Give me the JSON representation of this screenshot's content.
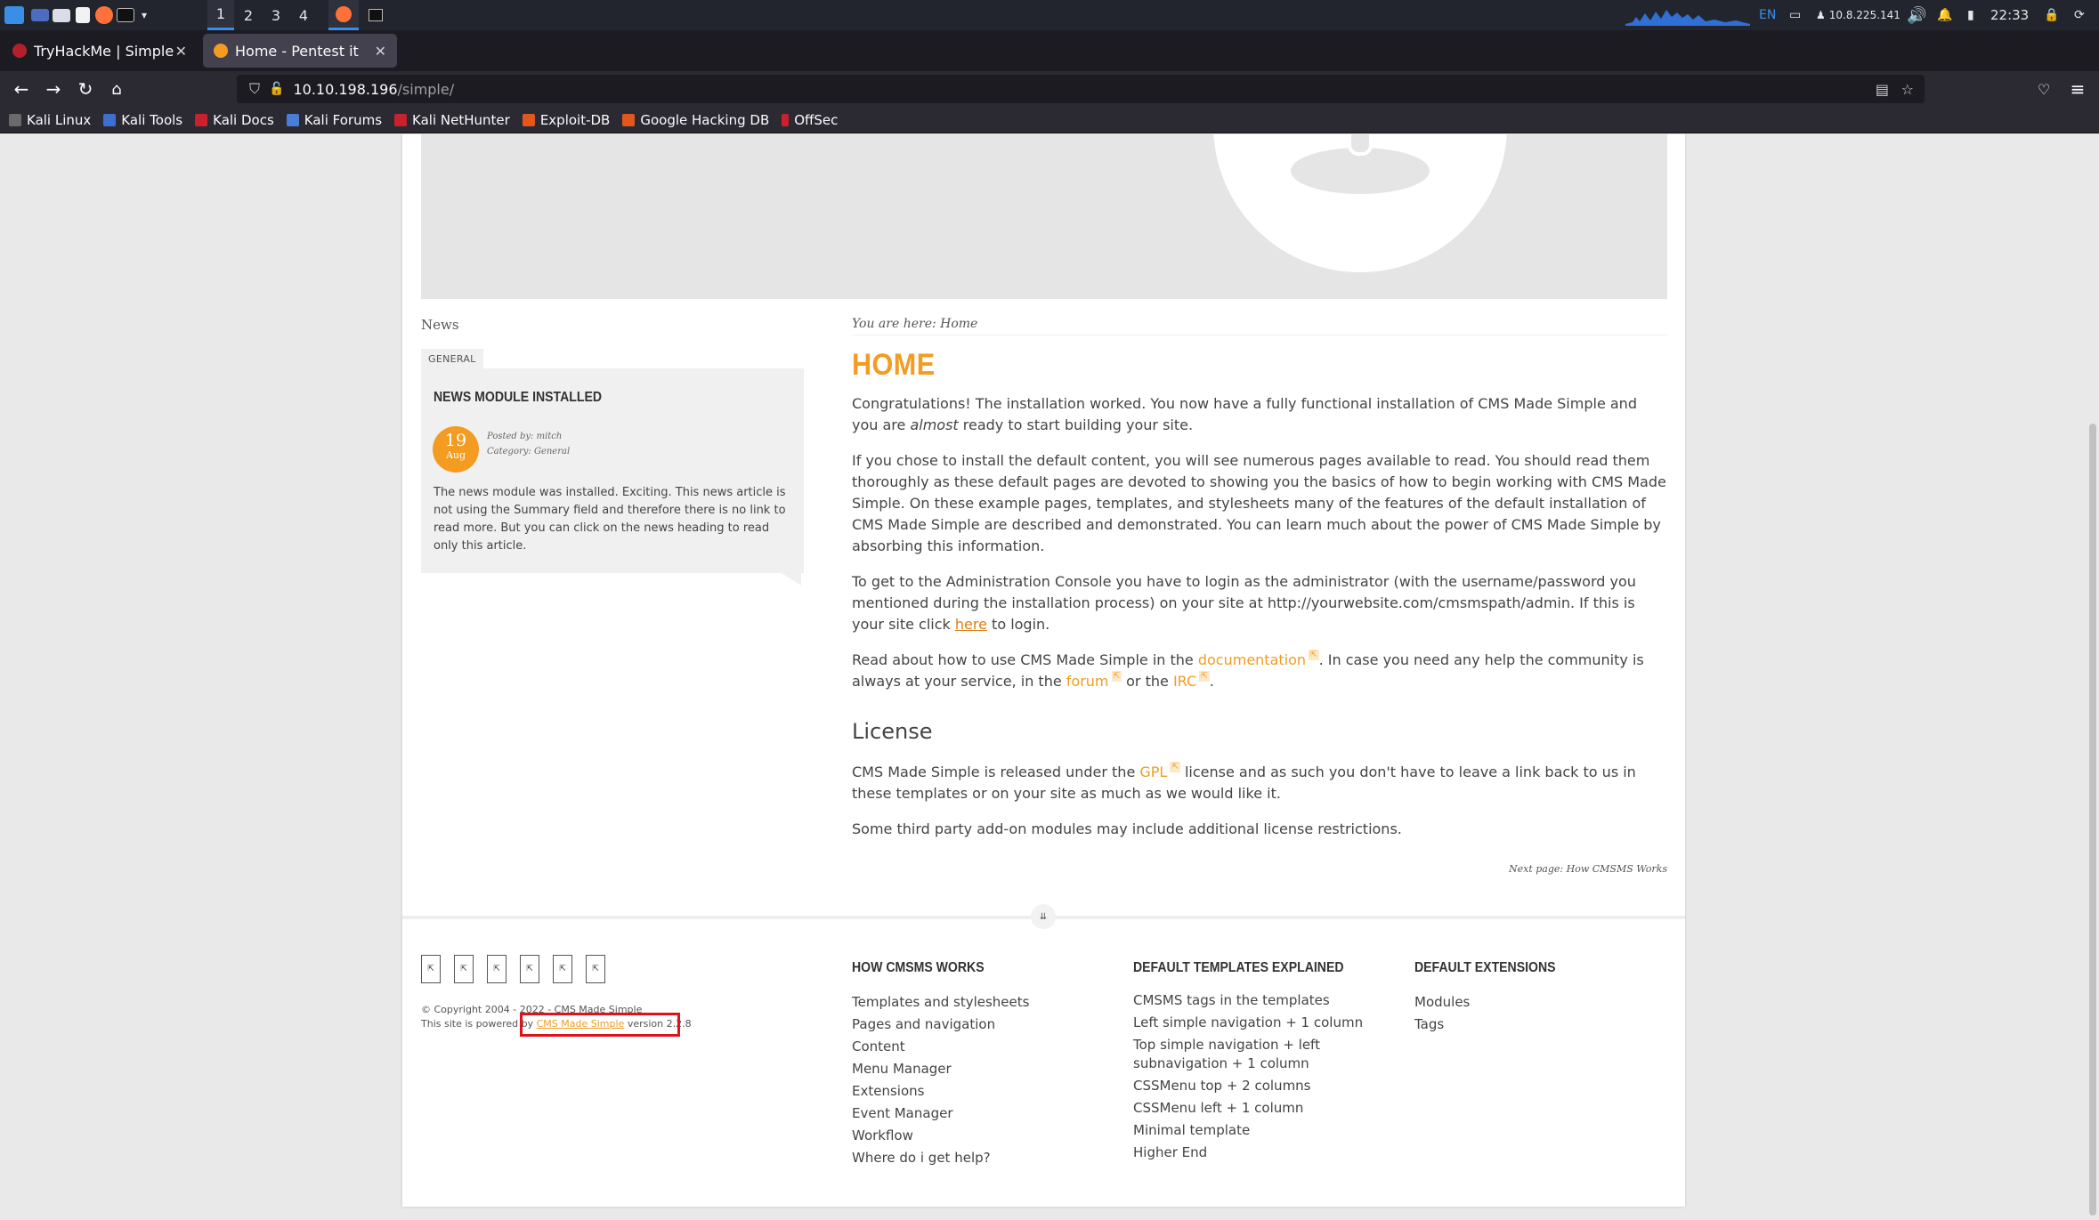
{
  "taskbar": {
    "workspaces": [
      "1",
      "2",
      "3",
      "4"
    ],
    "language": "EN",
    "ip": "10.8.225.141",
    "clock": "22:33"
  },
  "browser": {
    "tabs": [
      {
        "title": "TryHackMe | Simple CTF",
        "active": false
      },
      {
        "title": "Home - Pentest it",
        "active": true
      }
    ],
    "url_host": "10.10.198.196",
    "url_path": "/simple/",
    "bookmarks": [
      "Kali Linux",
      "Kali Tools",
      "Kali Docs",
      "Kali Forums",
      "Kali NetHunter",
      "Exploit-DB",
      "Google Hacking DB",
      "OffSec"
    ]
  },
  "sidebar": {
    "heading": "News",
    "tag": "GENERAL",
    "article_title": "NEWS MODULE INSTALLED",
    "date_day": "19",
    "date_month": "Aug",
    "posted_by": "Posted by: mitch",
    "category": "Category: General",
    "body": "The news module was installed. Exciting. This news article is not using the Summary field and therefore there is no link to read more. But you can click on the news heading to read only this article."
  },
  "main": {
    "breadcrumb": "You are here: Home",
    "title": "HOME",
    "p1_a": "Congratulations! The installation worked. You now have a fully functional installation of CMS Made Simple and you are ",
    "p1_em": "almost",
    "p1_b": " ready to start building your site.",
    "p2": "If you chose to install the default content, you will see numerous pages available to read. You should read them thoroughly as these default pages are devoted to showing you the basics of how to begin working with CMS Made Simple. On these example pages, templates, and stylesheets many of the features of the default installation of CMS Made Simple are described and demonstrated. You can learn much about the power of CMS Made Simple by absorbing this information.",
    "p3_a": "To get to the Administration Console you have to login as the administrator (with the username/password you mentioned during the installation process) on your site at http://yourwebsite.com/cmsmspath/admin. If this is your site click ",
    "p3_link": "here",
    "p3_b": " to login.",
    "p4_a": "Read about how to use CMS Made Simple in the ",
    "p4_link1": "documentation",
    "p4_b": ". In case you need any help the community is always at your service, in the ",
    "p4_link2": "forum",
    "p4_c": " or the ",
    "p4_link3": "IRC",
    "p4_d": ".",
    "license_heading": "License",
    "p5_a": "CMS Made Simple is released under the ",
    "p5_link": "GPL",
    "p5_b": " license and as such you don't have to leave a link back to us in these templates or on your site as much as we would like it.",
    "p6": "Some third party add-on modules may include additional license restrictions.",
    "next_page": "Next page: How CMSMS Works",
    "ext_glyph": "⇱"
  },
  "footer": {
    "copyright": "© Copyright 2004 - 2022 - CMS Made Simple",
    "powered_a": "This site is powered by ",
    "powered_link": "CMS Made Simple",
    "powered_b": " version 2.2.8",
    "col1_title": "HOW CMSMS WORKS",
    "col1": [
      "Templates and stylesheets",
      "Pages and navigation",
      "Content",
      "Menu Manager",
      "Extensions",
      "Event Manager",
      "Workflow",
      "Where do i get help?"
    ],
    "col2_title": "DEFAULT TEMPLATES EXPLAINED",
    "col2": [
      "CMSMS tags in the templates",
      "Left simple navigation + 1 column",
      "Top simple navigation + left subnavigation + 1 column",
      "CSSMenu top + 2 columns",
      "CSSMenu left + 1 column",
      "Minimal template",
      "Higher End"
    ],
    "col3_title": "DEFAULT EXTENSIONS",
    "col3": [
      "Modules",
      "Tags"
    ]
  },
  "colors": {
    "accent": "#f39c21",
    "highlight_box": "#e0121b"
  }
}
